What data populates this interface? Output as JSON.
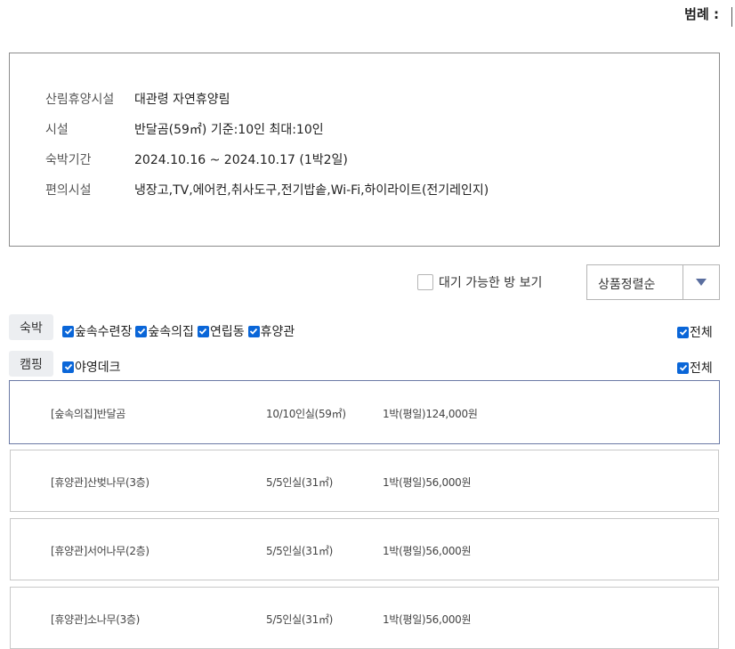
{
  "legend": {
    "label": "범례 :"
  },
  "facility_info": {
    "rows": [
      {
        "label": "산림휴양시설",
        "value": "대관령 자연휴양림"
      },
      {
        "label": "시설",
        "value": "반달곰(59㎡) 기준:10인 최대:10인"
      },
      {
        "label": "숙박기간",
        "value": "2024.10.16 ~ 2024.10.17 (1박2일)"
      },
      {
        "label": "편의시설",
        "value": "냉장고,TV,에어컨,취사도구,전기밥솥,Wi-Fi,하이라이트(전기레인지)"
      }
    ]
  },
  "filters": {
    "available_only": {
      "label": "대기 가능한 방 보기",
      "checked": false
    },
    "sort": {
      "selected": "상품정렬순"
    }
  },
  "categories": {
    "lodging": {
      "button": "숙박",
      "options": [
        {
          "label": "숲속수련장",
          "checked": true
        },
        {
          "label": "숲속의집",
          "checked": true
        },
        {
          "label": "연립동",
          "checked": true
        },
        {
          "label": "휴양관",
          "checked": true
        }
      ],
      "all": {
        "label": "전체",
        "checked": true
      }
    },
    "camping": {
      "button": "캠핑",
      "options": [
        {
          "label": "야영데크",
          "checked": true
        }
      ],
      "all": {
        "label": "전체",
        "checked": true
      }
    }
  },
  "rooms": [
    {
      "name": "[숲속의집]반달곰",
      "capacity": "10/10인실(59㎡)",
      "price": "1박(평일)124,000원",
      "selected": true
    },
    {
      "name": "[휴양관]산벚나무(3층)",
      "capacity": "5/5인실(31㎡)",
      "price": "1박(평일)56,000원",
      "selected": false
    },
    {
      "name": "[휴양관]서어나무(2층)",
      "capacity": "5/5인실(31㎡)",
      "price": "1박(평일)56,000원",
      "selected": false
    },
    {
      "name": "[휴양관]소나무(3층)",
      "capacity": "5/5인실(31㎡)",
      "price": "1박(평일)56,000원",
      "selected": false
    }
  ],
  "colors": {
    "checkbox": "#0a66d8",
    "selected_border": "#6b7aa6",
    "sort_arrow": "#5a6e9f"
  }
}
